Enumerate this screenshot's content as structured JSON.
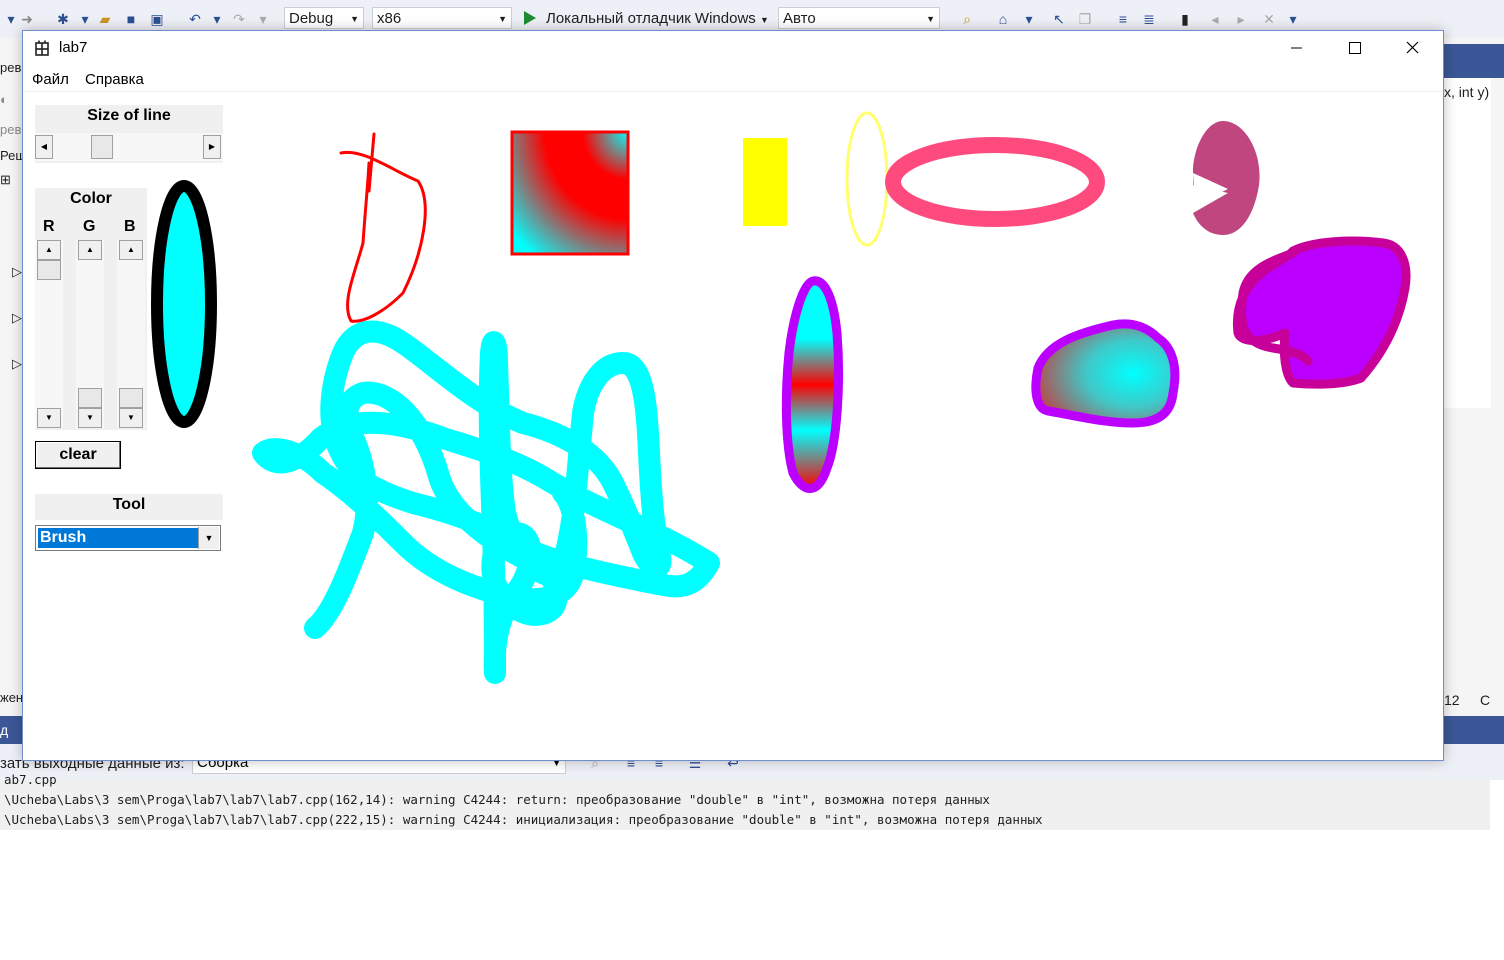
{
  "ide": {
    "config": "Debug",
    "platform": "x86",
    "run_target": "Локальный отладчик Windows",
    "run_mode": "Авто",
    "left_fragments": [
      "рев",
      "рев",
      "Реш"
    ],
    "signature_fragment": "x, int y)",
    "line_number": "12",
    "col_fragment": "С",
    "output_label": "зать выходные данные из:",
    "output_source": "Сборка",
    "output_lines": [
      "ab7.cpp",
      "\\Ucheba\\Labs\\3 sem\\Proga\\lab7\\lab7\\lab7.cpp(162,14): warning C4244: return: преобразование \"double\" в \"int\", возможна потеря данных",
      "\\Ucheba\\Labs\\3 sem\\Proga\\lab7\\lab7\\lab7.cpp(222,15): warning C4244: инициализация: преобразование \"double\" в \"int\", возможна потеря данных"
    ],
    "left_side_label1": "жен",
    "left_side_label2": "д"
  },
  "app": {
    "title": "lab7",
    "menu": [
      "Файл",
      "Справка"
    ],
    "size_group": {
      "title": "Size of line",
      "value_fraction": 0.3
    },
    "color_group": {
      "title": "Color",
      "channels": [
        {
          "label": "R",
          "value_fraction": 0.0
        },
        {
          "label": "G",
          "value_fraction": 1.0
        },
        {
          "label": "B",
          "value_fraction": 1.0
        }
      ],
      "preview_fill": "#00ffff",
      "preview_border": "#000000"
    },
    "clear_label": "clear",
    "tool_group": {
      "title": "Tool",
      "selected": "Brush"
    }
  }
}
